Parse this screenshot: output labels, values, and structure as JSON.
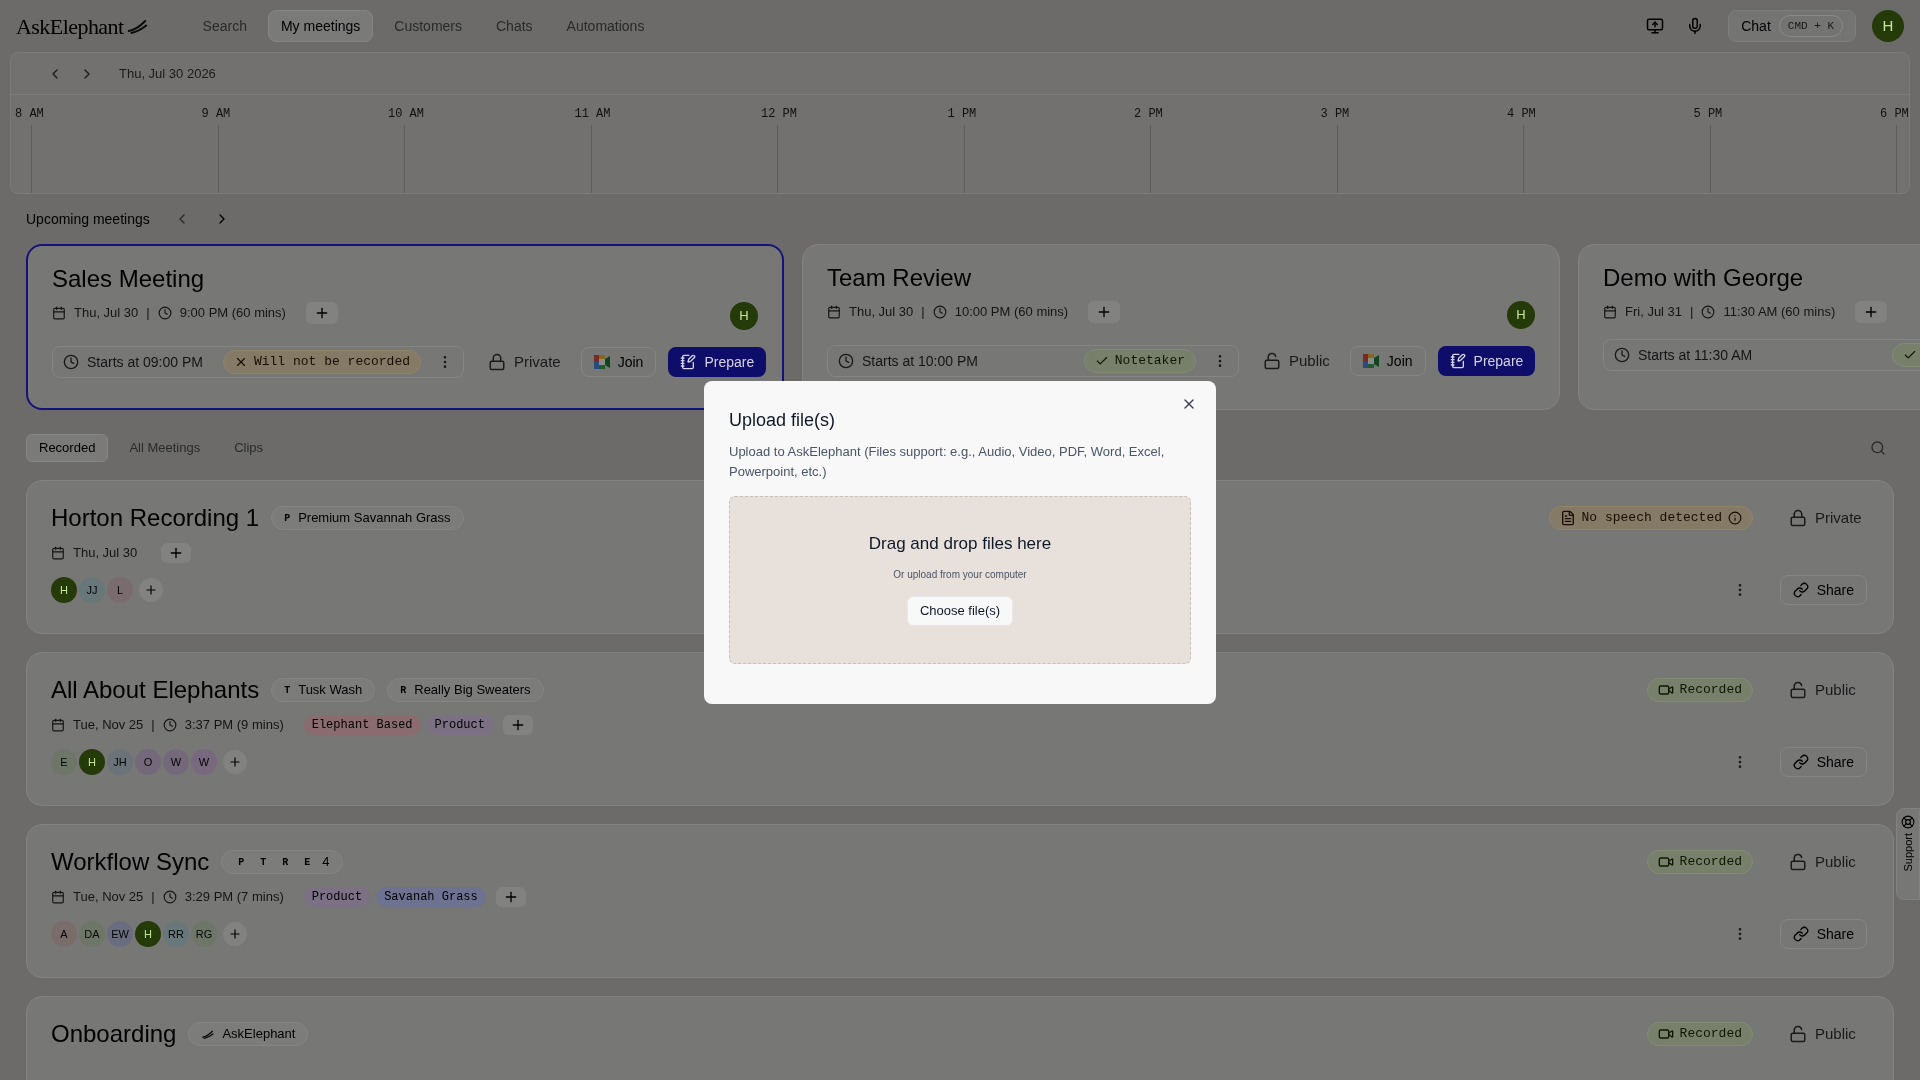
{
  "nav": {
    "logo": "AskElephant",
    "tabs": [
      {
        "label": "Search",
        "selected": false
      },
      {
        "label": "My meetings",
        "selected": true
      },
      {
        "label": "Customers",
        "selected": false
      },
      {
        "label": "Chats",
        "selected": false
      },
      {
        "label": "Automations",
        "selected": false
      }
    ],
    "chat": {
      "label": "Chat",
      "shortcut": "CMD + K"
    },
    "avatar": "H"
  },
  "calendar": {
    "date": "Thu, Jul 30 2026",
    "hours": [
      "8 AM",
      "9 AM",
      "10 AM",
      "11 AM",
      "12 PM",
      "1 PM",
      "2 PM",
      "3 PM",
      "4 PM",
      "5 PM",
      "6 PM"
    ]
  },
  "upcoming": {
    "title": "Upcoming meetings",
    "meetings": [
      {
        "title": "Sales Meeting",
        "date": "Thu, Jul 30",
        "separator": "|",
        "time": "9:00 PM (60 mins)",
        "avatar": "H",
        "starts": "Starts at 09:00 PM",
        "status": {
          "kind": "not_recorded",
          "label": "Will not be recorded"
        },
        "more_menu": true,
        "privacy": {
          "kind": "private",
          "label": "Private"
        },
        "join": "Join",
        "prepare": "Prepare",
        "selected": true
      },
      {
        "title": "Team Review",
        "date": "Thu, Jul 30",
        "separator": "|",
        "time": "10:00 PM (60 mins)",
        "avatar": "H",
        "starts": "Starts at 10:00 PM",
        "status": {
          "kind": "notetaker",
          "label": "Notetaker"
        },
        "more_menu": true,
        "privacy": {
          "kind": "public",
          "label": "Public"
        },
        "join": "Join",
        "prepare": "Prepare",
        "selected": false
      },
      {
        "title": "Demo with George",
        "date": "Fri, Jul 31",
        "separator": "|",
        "time": "11:30 AM (60 mins)",
        "starts": "Starts at 11:30 AM",
        "status": {
          "kind": "notetaker"
        },
        "selected": false
      }
    ]
  },
  "list_tabs": [
    {
      "label": "Recorded",
      "selected": true
    },
    {
      "label": "All Meetings",
      "selected": false
    },
    {
      "label": "Clips",
      "selected": false
    }
  ],
  "recordings": [
    {
      "title": "Horton Recording 1",
      "chips": [
        {
          "kind": "letter",
          "letter": "P",
          "label": "Premium Savannah Grass"
        }
      ],
      "date": "Thu, Jul 30",
      "participants": [
        {
          "initials": "H",
          "color": "#243a08"
        },
        {
          "initials": "JJ",
          "color": "#67777a"
        },
        {
          "initials": "L",
          "color": "#7a6b6e"
        }
      ],
      "status": {
        "kind": "no_speech",
        "label": "No speech detected"
      },
      "privacy": {
        "kind": "private",
        "label": "Private"
      },
      "share": "Share"
    },
    {
      "title": "All About Elephants",
      "chips": [
        {
          "kind": "letter",
          "letter": "T",
          "label": "Tusk Wash"
        },
        {
          "kind": "letter",
          "letter": "R",
          "label": "Really Big Sweaters"
        }
      ],
      "date": "Tue, Nov 25",
      "separator": "|",
      "time": "3:37 PM (9 mins)",
      "labels": [
        {
          "label": "Elephant Based",
          "color": "#8a6c70"
        },
        {
          "label": "Product",
          "color": "#7c7084"
        }
      ],
      "participants": [
        {
          "initials": "E",
          "color": "#6e7668"
        },
        {
          "initials": "H",
          "color": "#243a08"
        },
        {
          "initials": "JH",
          "color": "#6a737a"
        },
        {
          "initials": "O",
          "color": "#74697a"
        },
        {
          "initials": "W",
          "color": "#74697a"
        },
        {
          "initials": "W",
          "color": "#78697e"
        }
      ],
      "status": {
        "kind": "recorded",
        "label": "Recorded"
      },
      "privacy": {
        "kind": "public",
        "label": "Public"
      },
      "share": "Share"
    },
    {
      "title": "Workflow Sync",
      "chips": [
        {
          "kind": "group",
          "letters": [
            "P",
            "T",
            "R",
            "E"
          ],
          "label": "4"
        }
      ],
      "date": "Tue, Nov 25",
      "separator": "|",
      "time": "3:29 PM (7 mins)",
      "labels": [
        {
          "label": "Product",
          "color": "#7c7084"
        },
        {
          "label": "Savanah Grass",
          "color": "#6c7290"
        }
      ],
      "participants": [
        {
          "initials": "A",
          "color": "#7a6c69"
        },
        {
          "initials": "DA",
          "color": "#6e7668"
        },
        {
          "initials": "EW",
          "color": "#6a6d80"
        },
        {
          "initials": "H",
          "color": "#243a08"
        },
        {
          "initials": "RR",
          "color": "#67777a"
        },
        {
          "initials": "RG",
          "color": "#6e7668"
        }
      ],
      "status": {
        "kind": "recorded",
        "label": "Recorded"
      },
      "privacy": {
        "kind": "public",
        "label": "Public"
      },
      "share": "Share"
    },
    {
      "title": "Onboarding",
      "chips": [
        {
          "kind": "logo",
          "label": "AskElephant"
        }
      ],
      "status": {
        "kind": "recorded",
        "label": "Recorded"
      },
      "privacy": {
        "kind": "public",
        "label": "Public"
      }
    }
  ],
  "support": "Support",
  "dialog": {
    "title": "Upload file(s)",
    "description": "Upload to AskElephant (Files support: e.g., Audio, Video, PDF, Word, Excel, Powerpoint, etc.)",
    "drop_title": "Drag and drop files here",
    "drop_hint": "Or upload from your computer",
    "button": "Choose file(s)"
  }
}
